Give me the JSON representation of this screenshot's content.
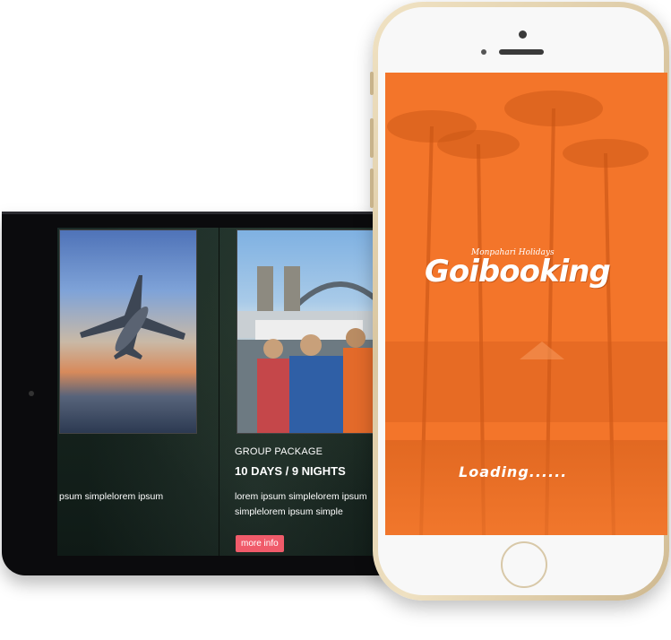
{
  "tablet": {
    "left_card": {
      "description": "psum simplelorem ipsum"
    },
    "right_card": {
      "title": "GROUP PACKAGE",
      "duration": "10 DAYS / 9 NIGHTS",
      "description": "lorem ipsum simplelorem ipsum simplelorem ipsum simple",
      "button_label": "more info"
    }
  },
  "phone": {
    "brand_tagline": "Monpahari Holidays",
    "brand_name": "Goibooking",
    "status_text": "Loading......",
    "accent_color": "#f3752a",
    "button_color": "#f05b6a"
  }
}
